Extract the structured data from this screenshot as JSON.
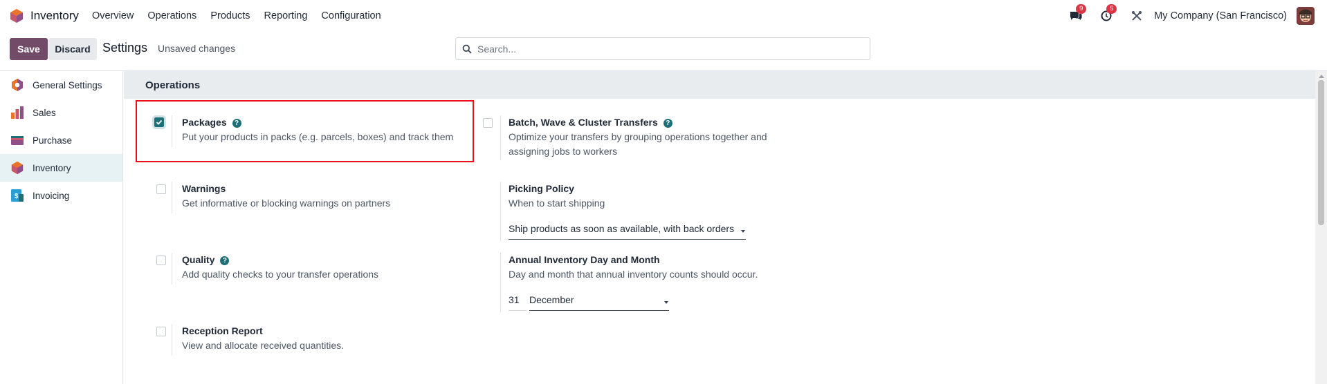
{
  "navbar": {
    "app_name": "Inventory",
    "menu": [
      "Overview",
      "Operations",
      "Products",
      "Reporting",
      "Configuration"
    ],
    "messages_count": "9",
    "activities_count": "5",
    "company": "My Company (San Francisco)"
  },
  "control_panel": {
    "save_label": "Save",
    "discard_label": "Discard",
    "title": "Settings",
    "status": "Unsaved changes",
    "search_placeholder": "Search..."
  },
  "sidebar": {
    "items": [
      {
        "label": "General Settings",
        "icon": "general-settings-icon",
        "active": false
      },
      {
        "label": "Sales",
        "icon": "sales-icon",
        "active": false
      },
      {
        "label": "Purchase",
        "icon": "purchase-icon",
        "active": false
      },
      {
        "label": "Inventory",
        "icon": "inventory-icon",
        "active": true
      },
      {
        "label": "Invoicing",
        "icon": "invoicing-icon",
        "active": false
      }
    ]
  },
  "section": {
    "title": "Operations",
    "settings": {
      "packages": {
        "title": "Packages",
        "desc": "Put your products in packs (e.g. parcels, boxes) and track them",
        "checked": true
      },
      "batch": {
        "title": "Batch, Wave & Cluster Transfers",
        "desc_line1": "Optimize your transfers by grouping operations together and",
        "desc_line2": "assigning jobs to workers",
        "checked": false
      },
      "warnings": {
        "title": "Warnings",
        "desc": "Get informative or blocking warnings on partners",
        "checked": false
      },
      "picking": {
        "title": "Picking Policy",
        "desc": "When to start shipping",
        "value": "Ship products as soon as available, with back orders"
      },
      "quality": {
        "title": "Quality",
        "desc": "Add quality checks to your transfer operations",
        "checked": false
      },
      "annual": {
        "title": "Annual Inventory Day and Month",
        "desc": "Day and month that annual inventory counts should occur.",
        "day": "31",
        "month": "December"
      },
      "reception": {
        "title": "Reception Report",
        "desc": "View and allocate received quantities.",
        "checked": false
      }
    }
  },
  "colors": {
    "primary": "#714b67",
    "accent": "#1d6f78",
    "highlight": "#e8131a"
  }
}
